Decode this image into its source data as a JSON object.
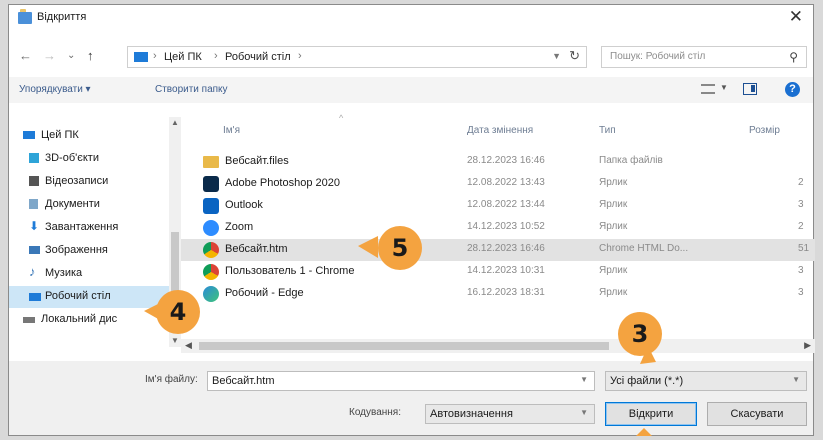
{
  "window": {
    "title": "Відкриття",
    "close_glyph": "✕"
  },
  "nav": {
    "back": "←",
    "forward": "→",
    "history": "⌄",
    "up": "↑",
    "breadcrumb": [
      "Цей ПК",
      "Робочий стіл"
    ],
    "search_placeholder": "Пошук: Робочий стіл"
  },
  "toolbar": {
    "organize": "Упорядкувати ▾",
    "new_folder": "Створити папку",
    "help": "?"
  },
  "sidebar": {
    "items": [
      {
        "label": "Цей ПК",
        "icon": "computer-icon",
        "color": "#1e7bd8"
      },
      {
        "label": "3D-об'єкти",
        "icon": "cube-icon",
        "color": "#2ea4d8"
      },
      {
        "label": "Відеозаписи",
        "icon": "film-icon",
        "color": "#555555"
      },
      {
        "label": "Документи",
        "icon": "document-icon",
        "color": "#7fa7c9"
      },
      {
        "label": "Завантаження",
        "icon": "download-icon",
        "color": "#1e7bd8"
      },
      {
        "label": "Зображення",
        "icon": "image-icon",
        "color": "#3a78b8"
      },
      {
        "label": "Музика",
        "icon": "music-icon",
        "color": "#3a78b8"
      },
      {
        "label": "Робочий стіл",
        "icon": "desktop-icon",
        "color": "#1e7bd8",
        "selected": true
      },
      {
        "label": "Локальний дис",
        "icon": "disk-icon",
        "color": "#777777"
      }
    ]
  },
  "columns": {
    "name": "Ім'я",
    "date": "Дата змінення",
    "type": "Тип",
    "size": "Розмір"
  },
  "files": [
    {
      "name": "Вебсайт.files",
      "date": "28.12.2023 16:46",
      "type": "Папка файлів",
      "size": "",
      "icon": "folder-icon",
      "color": "#e9b949"
    },
    {
      "name": "Adobe Photoshop 2020",
      "date": "12.08.2022 13:43",
      "type": "Ярлик",
      "size": "2",
      "icon": "photoshop-icon",
      "color": "#0a2a4a"
    },
    {
      "name": "Outlook",
      "date": "12.08.2022 13:44",
      "type": "Ярлик",
      "size": "3",
      "icon": "outlook-icon",
      "color": "#0a64c2"
    },
    {
      "name": "Zoom",
      "date": "14.12.2023 10:52",
      "type": "Ярлик",
      "size": "2",
      "icon": "zoom-icon",
      "color": "#2d8cff"
    },
    {
      "name": "Вебсайт.htm",
      "date": "28.12.2023 16:46",
      "type": "Chrome HTML Do...",
      "size": "51",
      "icon": "chrome-icon",
      "color": "#db4437",
      "selected": true
    },
    {
      "name": "Пользователь 1 - Chrome",
      "date": "14.12.2023 10:31",
      "type": "Ярлик",
      "size": "3",
      "icon": "chrome-user-icon",
      "color": "#db4437"
    },
    {
      "name": "Робочий - Edge",
      "date": "16.12.2023 18:31",
      "type": "Ярлик",
      "size": "3",
      "icon": "edge-icon",
      "color": "#2a8bd8"
    }
  ],
  "bottom": {
    "filename_label": "Ім'я файлу:",
    "filename_value": "Вебсайт.htm",
    "filter_value": "Усі файли (*.*)",
    "encoding_label": "Кодування:",
    "encoding_value": "Автовизначення",
    "open_label": "Відкрити",
    "cancel_label": "Скасувати"
  },
  "callouts": [
    "3",
    "4",
    "5"
  ],
  "colors": {
    "callout": "#f4a340",
    "selection": "#cde6f7",
    "accent": "#0078d7"
  }
}
